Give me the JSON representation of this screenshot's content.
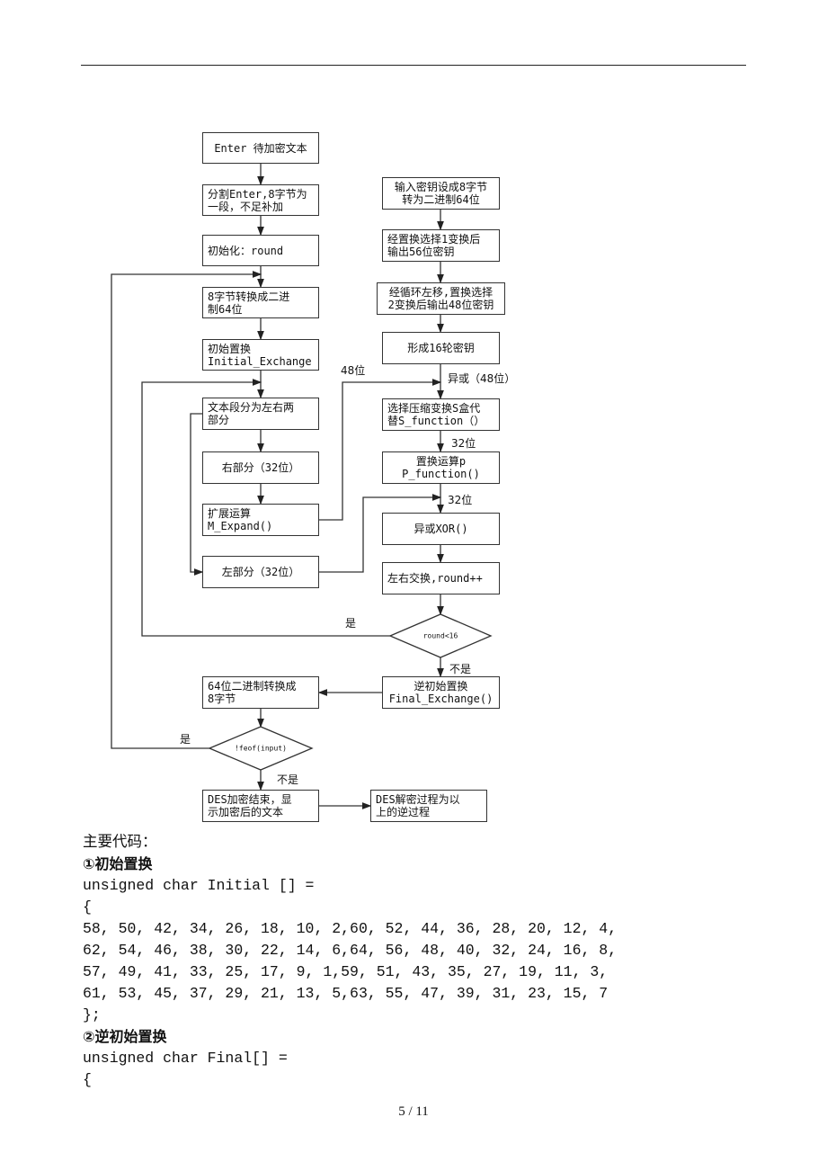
{
  "flowchart": {
    "nodes": {
      "enter": [
        "Enter 待加密文本"
      ],
      "split": [
        "分割Enter,8字节为",
        "一段，不足补加"
      ],
      "init": [
        "初始化：round"
      ],
      "to_bin": [
        "8字节转换成二进",
        "制64位"
      ],
      "initial_exchange": [
        "初始置换",
        "Initial_Exchange"
      ],
      "split_lr": [
        "文本段分为左右两",
        "部分"
      ],
      "right": [
        "右部分（32位）"
      ],
      "expand": [
        "扩展运算",
        "M_Expand()"
      ],
      "left": [
        "左部分（32位）"
      ],
      "to_bytes": [
        "64位二进制转换成",
        "8字节"
      ],
      "feof": [
        "!feof(input)"
      ],
      "enc_end": [
        "DES加密结束，显",
        "示加密后的文本"
      ],
      "key_in": [
        "输入密钥设成8字节",
        "转为二进制64位"
      ],
      "pc1": [
        "经置换选择1变换后",
        "输出56位密钥"
      ],
      "pc2": [
        "经循环左移,置换选择",
        "2变换后输出48位密钥"
      ],
      "keys16": [
        "形成16轮密钥"
      ],
      "sbox": [
        "选择压缩变换S盒代",
        "替S_function（）"
      ],
      "pbox": [
        "置换运算p",
        "P_function()"
      ],
      "xor": [
        "异或XOR()"
      ],
      "swap": [
        "左右交换,round++"
      ],
      "round_check": [
        "round<16"
      ],
      "final_exchange": [
        "逆初始置换",
        "Final_Exchange()"
      ],
      "decrypt": [
        "DES解密过程为以",
        "上的逆过程"
      ]
    },
    "labels": {
      "bits48_expand": "48位",
      "xor48": "异或（48位）",
      "bits32_s": "32位",
      "bits32_p": "32位",
      "yes_round": "是",
      "no_round": "不是",
      "yes_feof": "是",
      "no_feof": "不是"
    }
  },
  "document": {
    "section_title": "主要代码：",
    "heading1": "①初始置换",
    "code1": [
      "unsigned char Initial [] =",
      "{",
      "58, 50, 42, 34, 26, 18, 10, 2,60, 52, 44, 36, 28, 20, 12, 4,",
      "62, 54, 46, 38, 30, 22, 14, 6,64, 56, 48, 40, 32, 24, 16, 8,",
      "57, 49, 41, 33, 25, 17, 9, 1,59, 51, 43, 35, 27, 19, 11, 3,",
      "61, 53, 45, 37, 29, 21, 13, 5,63, 55, 47, 39, 31, 23, 15, 7",
      "};"
    ],
    "heading2": "②逆初始置换",
    "code2": [
      "unsigned char Final[] =",
      "{"
    ]
  },
  "footer": {
    "page": "5 / 11"
  }
}
